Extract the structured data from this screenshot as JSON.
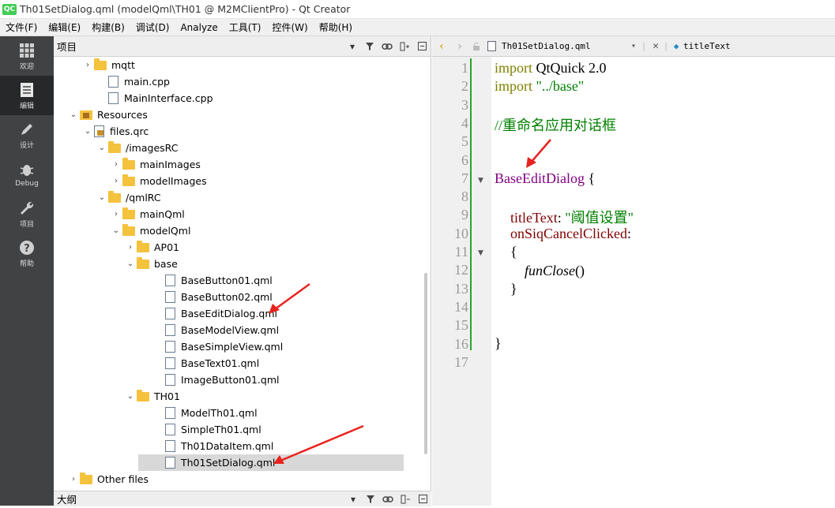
{
  "window": {
    "title": "Th01SetDialog.qml (modelQml\\TH01 @ M2MClientPro) - Qt Creator",
    "logo": "QC"
  },
  "menu": [
    "文件(F)",
    "编辑(E)",
    "构建(B)",
    "调试(D)",
    "Analyze",
    "工具(T)",
    "控件(W)",
    "帮助(H)"
  ],
  "modes": [
    {
      "label": "欢迎",
      "icon": "grid-icon"
    },
    {
      "label": "编辑",
      "icon": "document-icon"
    },
    {
      "label": "设计",
      "icon": "pencil-icon"
    },
    {
      "label": "Debug",
      "icon": "bug-icon"
    },
    {
      "label": "项目",
      "icon": "wrench-icon"
    },
    {
      "label": "帮助",
      "icon": "help-icon"
    }
  ],
  "project_panel": {
    "title": "项目",
    "outline_title": "大纲"
  },
  "tree": [
    {
      "label": "mqtt",
      "kind": "folder",
      "arrow": "›"
    },
    {
      "label": "main.cpp",
      "kind": "cpp",
      "arrow": ""
    },
    {
      "label": "MainInterface.cpp",
      "kind": "cpp",
      "arrow": ""
    },
    {
      "label": "Resources",
      "kind": "resfolder",
      "arrow": "⌄"
    },
    {
      "label": "files.qrc",
      "kind": "qrc",
      "arrow": "⌄"
    },
    {
      "label": "/imagesRC",
      "kind": "folder",
      "arrow": "⌄"
    },
    {
      "label": "mainImages",
      "kind": "folder",
      "arrow": "›"
    },
    {
      "label": "modelImages",
      "kind": "folder",
      "arrow": "›"
    },
    {
      "label": "/qmlRC",
      "kind": "folder",
      "arrow": "⌄"
    },
    {
      "label": "mainQml",
      "kind": "folder",
      "arrow": "›"
    },
    {
      "label": "modelQml",
      "kind": "folder",
      "arrow": "⌄"
    },
    {
      "label": "AP01",
      "kind": "folder",
      "arrow": "›"
    },
    {
      "label": "base",
      "kind": "folder",
      "arrow": "⌄"
    },
    {
      "label": "BaseButton01.qml",
      "kind": "qml",
      "arrow": ""
    },
    {
      "label": "BaseButton02.qml",
      "kind": "qml",
      "arrow": ""
    },
    {
      "label": "BaseEditDialog.qml",
      "kind": "qml",
      "arrow": ""
    },
    {
      "label": "BaseModelView.qml",
      "kind": "qml",
      "arrow": ""
    },
    {
      "label": "BaseSimpleView.qml",
      "kind": "qml",
      "arrow": ""
    },
    {
      "label": "BaseText01.qml",
      "kind": "qml",
      "arrow": ""
    },
    {
      "label": "ImageButton01.qml",
      "kind": "qml",
      "arrow": ""
    },
    {
      "label": "TH01",
      "kind": "folder",
      "arrow": "⌄"
    },
    {
      "label": "ModelTh01.qml",
      "kind": "qml",
      "arrow": ""
    },
    {
      "label": "SimpleTh01.qml",
      "kind": "qml",
      "arrow": ""
    },
    {
      "label": "Th01DataItem.qml",
      "kind": "qml",
      "arrow": ""
    },
    {
      "label": "Th01SetDialog.qml",
      "kind": "qml",
      "arrow": "",
      "selected": true
    },
    {
      "label": "Other files",
      "kind": "folder",
      "arrow": "›"
    }
  ],
  "editor": {
    "file_tab": "Th01SetDialog.qml",
    "symbol": "titleText",
    "line_numbers": [
      "1",
      "2",
      "3",
      "4",
      "5",
      "6",
      "7",
      "8",
      "9",
      "10",
      "11",
      "12",
      "13",
      "14",
      "15",
      "16",
      "17"
    ],
    "code": {
      "l1_kw": "import",
      "l1_rest": " QtQuick 2.0",
      "l2_kw": "import",
      "l2_str": " \"../base\"",
      "l4_cmt": "//重命名应用对话框",
      "l7_type": "BaseEditDialog",
      "l7_rest": " {",
      "l9_prop": "titleText",
      "l9_colon": ": ",
      "l9_str": "\"阈值设置\"",
      "l10_prop": "onSiqCancelClicked",
      "l10_colon": ":",
      "l11": "{",
      "l12_fn": "funClose",
      "l12_rest": "()",
      "l13": "}",
      "l16": "}"
    }
  },
  "colors": {
    "sidebar": "#404244",
    "sidebar_active": "#262829",
    "folder": "#f5c23e",
    "change_bar": "#2aa42a",
    "annotation_arrow": "#e8231e"
  }
}
